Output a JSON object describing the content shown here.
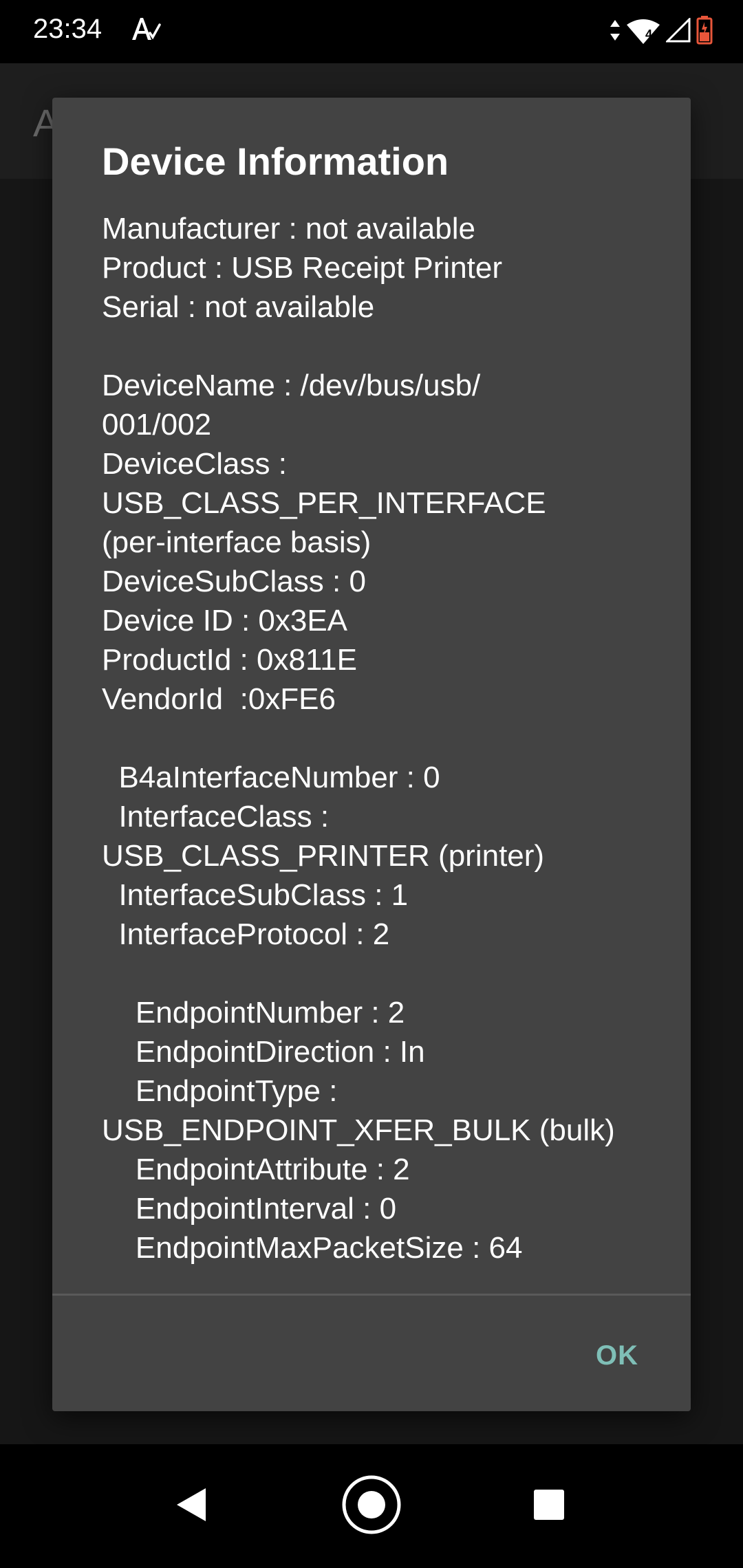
{
  "status_bar": {
    "time": "23:34",
    "network_label": "4",
    "icons": [
      "auto-a-icon",
      "data-arrows-icon",
      "wifi-icon",
      "signal-icon",
      "battery-charging-icon"
    ]
  },
  "app_bar": {
    "title": "A"
  },
  "dialog": {
    "title": "Device Information",
    "message": "Manufacturer : not available\nProduct : USB Receipt Printer\nSerial : not available\n\nDeviceName : /dev/bus/usb/\n001/002\nDeviceClass :\nUSB_CLASS_PER_INTERFACE\n(per-interface basis)\nDeviceSubClass : 0\nDevice ID : 0x3EA\nProductId : 0x811E\nVendorId  :0xFE6\n\n  B4aInterfaceNumber : 0\n  InterfaceClass :\nUSB_CLASS_PRINTER (printer)\n  InterfaceSubClass : 1\n  InterfaceProtocol : 2\n\n    EndpointNumber : 2\n    EndpointDirection : In\n    EndpointType :\nUSB_ENDPOINT_XFER_BULK (bulk)\n    EndpointAttribute : 2\n    EndpointInterval : 0\n    EndpointMaxPacketSize : 64",
    "ok_label": "OK"
  },
  "nav_bar": {
    "icons": [
      "back-icon",
      "home-icon",
      "recents-icon"
    ]
  },
  "colors": {
    "dialog_background": "#434343",
    "accent": "#7fbfb7",
    "scrim": "#161616",
    "battery": "#e8563a"
  }
}
